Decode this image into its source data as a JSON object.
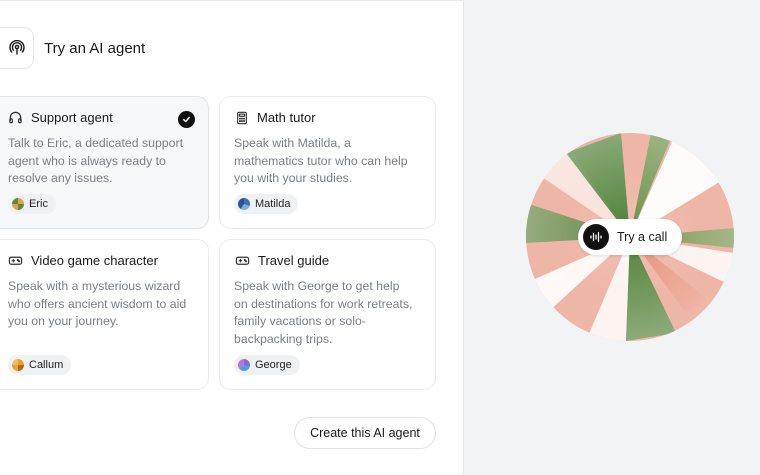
{
  "header": {
    "title": "Try an AI agent",
    "icon": "podcast-icon"
  },
  "agents": [
    {
      "title": "Support agent",
      "icon": "headphones-icon",
      "description": [
        "Talk to Eric, a dedicated support",
        "agent who is always ready to",
        "resolve any issues."
      ],
      "voice": "Eric",
      "selected": true,
      "avatar_colors": [
        "#e0a050",
        "#5a8a3a"
      ]
    },
    {
      "title": "Math tutor",
      "icon": "calculator-icon",
      "description": [
        "Speak with Matilda, a",
        "mathematics tutor who can help",
        "you with your studies."
      ],
      "voice": "Matilda",
      "selected": false,
      "avatar_colors": [
        "#3a6fb0",
        "#7ab0d8"
      ]
    },
    {
      "title": "Video game character",
      "icon": "gamepad-icon",
      "description": [
        "Speak with a mysterious wizard",
        "who offers ancient wisdom to aid",
        "you on your journey."
      ],
      "voice": "Callum",
      "selected": false,
      "avatar_colors": [
        "#e8a030",
        "#c06020"
      ]
    },
    {
      "title": "Travel guide",
      "icon": "gamepad-icon",
      "description": [
        "Speak with George to get help",
        "on destinations for work retreats,",
        "family vacations or solo-",
        "backpacking trips."
      ],
      "voice": "George",
      "selected": false,
      "avatar_colors": [
        "#8a6ad0",
        "#4aa0e0"
      ]
    }
  ],
  "create_button": {
    "label": "Create this AI agent"
  },
  "call": {
    "label": "Try a call",
    "icon": "soundwave-icon"
  },
  "colors": {
    "orb_green": "#3d7a2a",
    "orb_salmon": "#e99a86",
    "orb_white": "#ffffff"
  }
}
